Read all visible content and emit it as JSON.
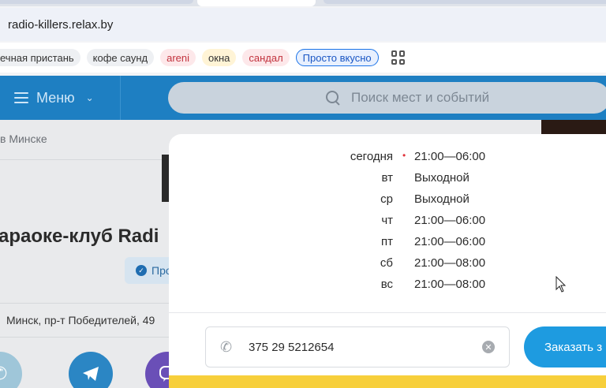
{
  "browser": {
    "url": "radio-killers.relax.by",
    "bookmarks": [
      {
        "label": "ечная пристань",
        "style": "first"
      },
      {
        "label": "кофе саунд",
        "style": "gray"
      },
      {
        "label": "areni",
        "style": "pink"
      },
      {
        "label": "окна",
        "style": "yellow"
      },
      {
        "label": "сандал",
        "style": "pink"
      },
      {
        "label": "Просто вкусно",
        "style": "outlined"
      }
    ],
    "apps_icon": "grid-icon"
  },
  "site": {
    "menu_label": "Меню",
    "search_placeholder": "Поиск мест и событий",
    "breadcrumb": "в Минске",
    "title": "араоке-клуб Radi",
    "verified_label": "Про",
    "address": "Минск, пр-т Победителей, 49",
    "colors": {
      "header": "#1e7fc2",
      "accent": "#1e9be0",
      "cta_bar": "#f7cf3b"
    }
  },
  "modal": {
    "hours": [
      {
        "day": "сегодня",
        "time": "21:00—06:00",
        "today": true
      },
      {
        "day": "вт",
        "time": "Выходной",
        "today": false
      },
      {
        "day": "ср",
        "time": "Выходной",
        "today": false
      },
      {
        "day": "чт",
        "time": "21:00—06:00",
        "today": false
      },
      {
        "day": "пт",
        "time": "21:00—06:00",
        "today": false
      },
      {
        "day": "сб",
        "time": "21:00—08:00",
        "today": false
      },
      {
        "day": "вс",
        "time": "21:00—08:00",
        "today": false
      }
    ],
    "today_marker": "•",
    "phone": "375 29 5212654",
    "order_button": "Заказать з"
  }
}
